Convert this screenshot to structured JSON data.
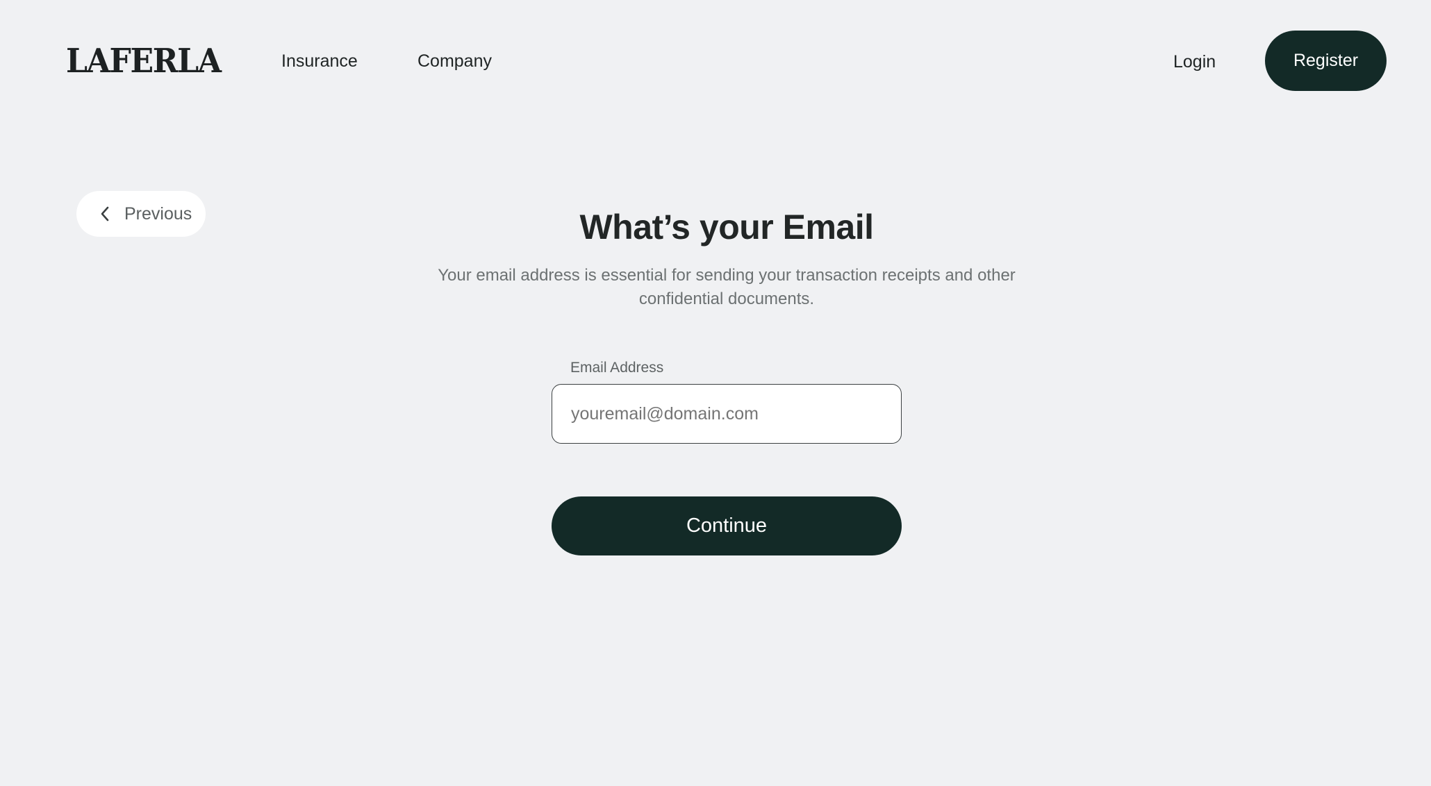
{
  "header": {
    "logo": "LAFERLA",
    "nav": {
      "insurance": "Insurance",
      "company": "Company"
    },
    "login_label": "Login",
    "register_label": "Register"
  },
  "previous_button": {
    "icon": "chevron-left-icon",
    "label": "Previous"
  },
  "form": {
    "title": "What’s your Email",
    "subtitle": "Your email address is essential for sending your transaction receipts and other confidential documents.",
    "email_label": "Email Address",
    "email_placeholder": "youremail@domain.com",
    "continue_label": "Continue"
  },
  "colors": {
    "background": "#f0f1f3",
    "primary": "#132a27",
    "text": "#1f2424"
  }
}
